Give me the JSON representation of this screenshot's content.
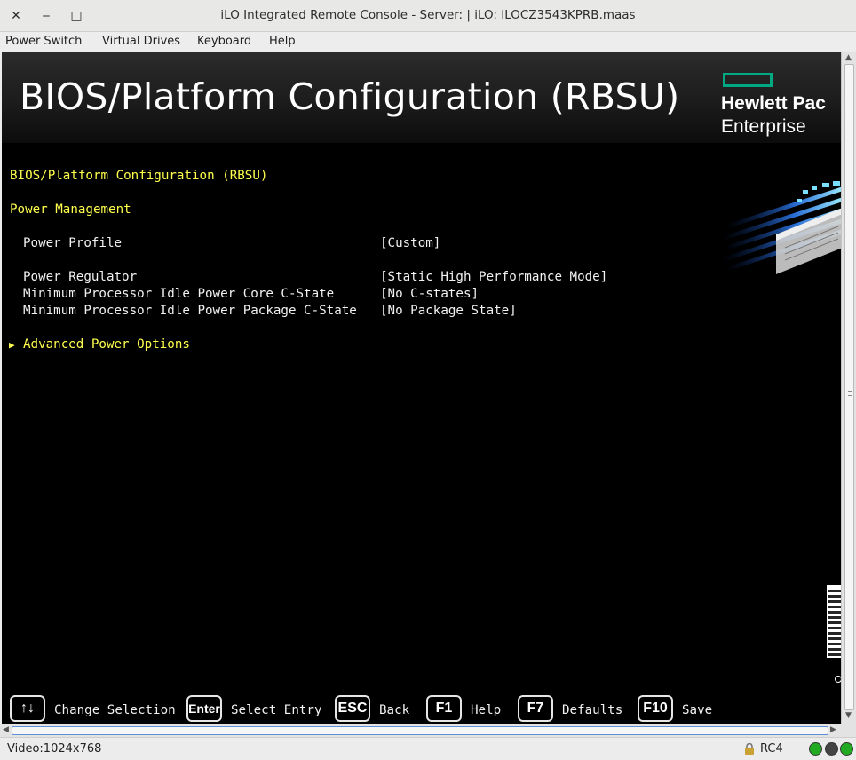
{
  "window": {
    "title": "iLO Integrated Remote Console - Server:  | iLO: ILOCZ3543KPRB.maas",
    "close_glyph": "✕",
    "minimize_glyph": "‒",
    "maximize_glyph": "□"
  },
  "menu": {
    "items": [
      "Power Switch",
      "Virtual Drives",
      "Keyboard",
      "Help"
    ]
  },
  "banner": {
    "title": "BIOS/Platform Configuration (RBSU)",
    "brand_line1": "Hewlett Pac",
    "brand_line2": "Enterprise",
    "brand_color": "#01a982"
  },
  "screen": {
    "breadcrumb": "BIOS/Platform Configuration (RBSU)",
    "section": "Power Management",
    "settings": [
      {
        "label": "Power Profile",
        "value": "[Custom]"
      },
      {
        "label": "Power Regulator",
        "value": "[Static High Performance Mode]"
      },
      {
        "label": "Minimum Processor Idle Power Core C-State",
        "value": "[No C-states]"
      },
      {
        "label": "Minimum Processor Idle Power Package C-State",
        "value": "[No Package State]"
      }
    ],
    "submenu": {
      "arrow": "▶",
      "label": "Advanced Power Options"
    },
    "text_color": "#ffff4d"
  },
  "legend": [
    {
      "key": "↑↓",
      "label": "Change Selection"
    },
    {
      "key": "Enter",
      "label": "Select Entry"
    },
    {
      "key": "ESC",
      "label": "Back"
    },
    {
      "key": "F1",
      "label": "Help"
    },
    {
      "key": "F7",
      "label": "Defaults"
    },
    {
      "key": "F10",
      "label": "Save"
    }
  ],
  "status": {
    "video": "Video:1024x768",
    "encryption": "RC4",
    "indicators": [
      "#22aa22",
      "#444444",
      "#22aa22"
    ]
  }
}
